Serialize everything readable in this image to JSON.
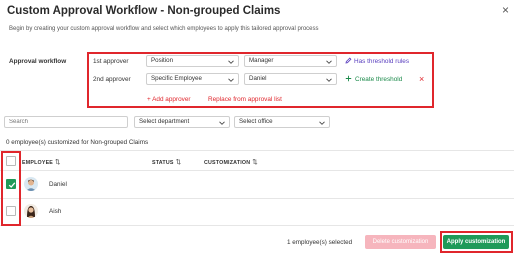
{
  "header": {
    "title": "Custom Approval Workflow - Non-grouped Claims",
    "subtitle": "Begin by creating your custom approval workflow and select which employees to apply this tailored approval process",
    "close_icon": "×"
  },
  "workflow": {
    "label": "Approval workflow",
    "approvers": [
      {
        "label": "1st approver",
        "type": "Position",
        "value": "Manager",
        "action": "Has threshold rules",
        "action_icon": "pencil-icon"
      },
      {
        "label": "2nd approver",
        "type": "Specific Employee",
        "value": "Daniel",
        "action": "Create threshold",
        "action_icon": "plus-icon",
        "remove_icon": "×"
      }
    ],
    "add_approver": "+ Add approver",
    "replace": "Replace from approval list"
  },
  "filters": {
    "search_placeholder": "Search",
    "department": "Select department",
    "office": "Select office"
  },
  "summary": {
    "count_text": "0 employee(s) customized for Non-grouped Claims"
  },
  "table": {
    "columns": {
      "employee": "EMPLOYEE",
      "status": "STATUS",
      "customization": "CUSTOMIZATION"
    },
    "rows": [
      {
        "name": "Daniel",
        "checked": true
      },
      {
        "name": "Aish",
        "checked": false
      }
    ]
  },
  "footer": {
    "selected_text": "1 employee(s) selected",
    "delete_label": "Delete customization",
    "apply_label": "Apply customization"
  },
  "colors": {
    "accent_green": "#1f9a59",
    "highlight_red": "#e0262c",
    "link_purple": "#5a3fbf",
    "delete_disabled": "#f6b5bd"
  }
}
